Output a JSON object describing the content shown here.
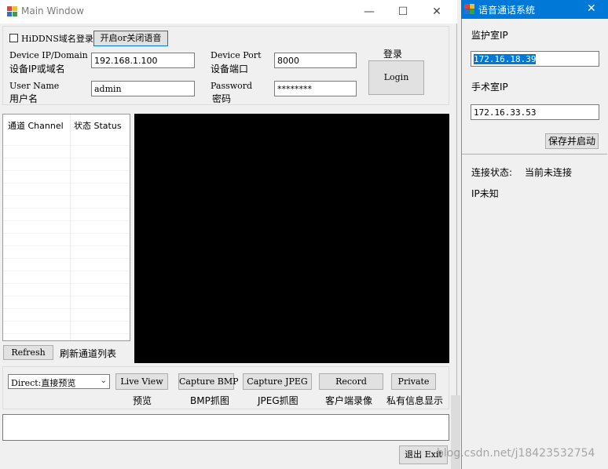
{
  "main_window": {
    "title": "Main Window",
    "controls": {
      "minimize": "—",
      "maximize": "☐",
      "close": "✕"
    },
    "hiddns_label": "HiDDNS域名登录",
    "voice_toggle_label": "开启or关闭语音",
    "device_ip_label_en": "Device IP/Domain",
    "device_ip_label_cn": "设备IP或域名",
    "device_ip_value": "192.168.1.100",
    "device_port_label_en": "Device Port",
    "device_port_label_cn": "设备端口",
    "device_port_value": "8000",
    "login_caption": "登录",
    "login_button": "Login",
    "username_label_en": "User Name",
    "username_label_cn": "用户名",
    "username_value": "admin",
    "password_label_en": "Password",
    "password_label_cn": "密码",
    "password_value": "********",
    "channel_list": {
      "col_channel": "通道 Channel",
      "col_status": "状态 Status"
    },
    "refresh_button": "Refresh",
    "refresh_caption": "刷新通道列表",
    "stream_select_value": "Direct:直接预览",
    "live_view_button": "Live View",
    "live_view_caption": "预览",
    "capture_bmp_button": "Capture BMP",
    "capture_bmp_caption": "BMP抓图",
    "capture_jpeg_button": "Capture JPEG",
    "capture_jpeg_caption": "JPEG抓图",
    "record_button": "Record",
    "record_caption": "客户端录像",
    "private_button": "Private",
    "private_caption": "私有信息显示",
    "exit_button": "退出 Exit"
  },
  "voice_window": {
    "title": "语音通话系统",
    "close": "✕",
    "monitor_ip_label": "监护室IP",
    "monitor_ip_value": "172.16.18.39",
    "surgery_ip_label": "手术室IP",
    "surgery_ip_value": "172.16.33.53",
    "save_start_button": "保存并启动",
    "conn_status_label": "连接状态:",
    "conn_status_value": "当前未连接",
    "ip_unknown": "IP未知"
  },
  "watermark": "blog.csdn.net/j18423532754",
  "colors": {
    "accent": "#0078d7",
    "video_bg": "#000000",
    "window_bg": "#f0f0f0"
  }
}
